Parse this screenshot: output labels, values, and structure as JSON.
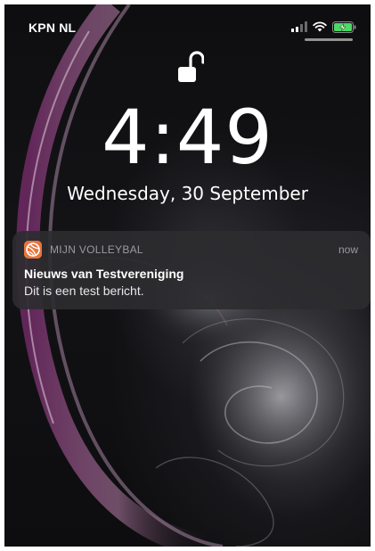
{
  "status_bar": {
    "carrier": "KPN NL",
    "icons": [
      "cellular-signal-icon",
      "wifi-icon",
      "battery-charging-icon"
    ],
    "battery_color": "#4cd964"
  },
  "lock_screen": {
    "lock_state_icon": "unlocked-padlock-icon",
    "time": "4:49",
    "date": "Wednesday, 30 September"
  },
  "notification": {
    "app_icon": "volleyball-app-icon",
    "app_name": "MIJN VOLLEYBAL",
    "time": "now",
    "title": "Nieuws van Testvereniging",
    "body": "Dit is een test bericht.",
    "app_icon_color": "#e8743b"
  }
}
